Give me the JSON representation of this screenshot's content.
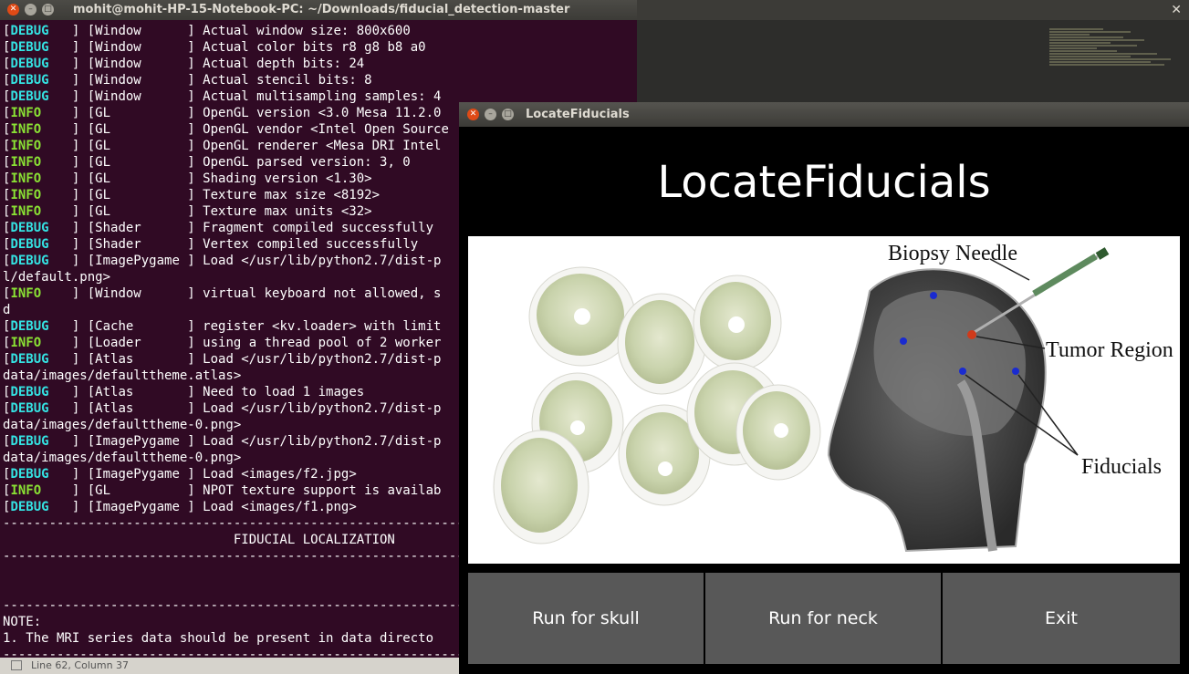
{
  "terminal": {
    "title": "mohit@mohit-HP-15-Notebook-PC: ~/Downloads/fiducial_detection-master",
    "lines": [
      {
        "level": "DEBUG",
        "text": "   ] [Window      ] Actual window size: 800x600"
      },
      {
        "level": "DEBUG",
        "text": "   ] [Window      ] Actual color bits r8 g8 b8 a0"
      },
      {
        "level": "DEBUG",
        "text": "   ] [Window      ] Actual depth bits: 24"
      },
      {
        "level": "DEBUG",
        "text": "   ] [Window      ] Actual stencil bits: 8"
      },
      {
        "level": "DEBUG",
        "text": "   ] [Window      ] Actual multisampling samples: 4"
      },
      {
        "level": "INFO",
        "text": "    ] [GL          ] OpenGL version <3.0 Mesa 11.2.0"
      },
      {
        "level": "INFO",
        "text": "    ] [GL          ] OpenGL vendor <Intel Open Source"
      },
      {
        "level": "INFO",
        "text": "    ] [GL          ] OpenGL renderer <Mesa DRI Intel"
      },
      {
        "level": "INFO",
        "text": "    ] [GL          ] OpenGL parsed version: 3, 0"
      },
      {
        "level": "INFO",
        "text": "    ] [GL          ] Shading version <1.30>"
      },
      {
        "level": "INFO",
        "text": "    ] [GL          ] Texture max size <8192>"
      },
      {
        "level": "INFO",
        "text": "    ] [GL          ] Texture max units <32>"
      },
      {
        "level": "DEBUG",
        "text": "   ] [Shader      ] Fragment compiled successfully"
      },
      {
        "level": "DEBUG",
        "text": "   ] [Shader      ] Vertex compiled successfully"
      },
      {
        "level": "DEBUG",
        "text": "   ] [ImagePygame ] Load </usr/lib/python2.7/dist-p"
      },
      {
        "level": "",
        "text": "l/default.png>"
      },
      {
        "level": "INFO",
        "text": "    ] [Window      ] virtual keyboard not allowed, s"
      },
      {
        "level": "",
        "text": "d"
      },
      {
        "level": "DEBUG",
        "text": "   ] [Cache       ] register <kv.loader> with limit"
      },
      {
        "level": "INFO",
        "text": "    ] [Loader      ] using a thread pool of 2 worker"
      },
      {
        "level": "DEBUG",
        "text": "   ] [Atlas       ] Load </usr/lib/python2.7/dist-p"
      },
      {
        "level": "",
        "text": "data/images/defaulttheme.atlas>"
      },
      {
        "level": "DEBUG",
        "text": "   ] [Atlas       ] Need to load 1 images"
      },
      {
        "level": "DEBUG",
        "text": "   ] [Atlas       ] Load </usr/lib/python2.7/dist-p"
      },
      {
        "level": "",
        "text": "data/images/defaulttheme-0.png>"
      },
      {
        "level": "DEBUG",
        "text": "   ] [ImagePygame ] Load </usr/lib/python2.7/dist-p"
      },
      {
        "level": "",
        "text": "data/images/defaulttheme-0.png>"
      },
      {
        "level": "DEBUG",
        "text": "   ] [ImagePygame ] Load <images/f2.jpg>"
      },
      {
        "level": "INFO",
        "text": "    ] [GL          ] NPOT texture support is availab"
      },
      {
        "level": "DEBUG",
        "text": "   ] [ImagePygame ] Load <images/f1.png>"
      },
      {
        "level": "",
        "text": "------------------------------------------------------------------------"
      },
      {
        "level": "",
        "text": "                              FIDUCIAL LOCALIZATION"
      },
      {
        "level": "",
        "text": "------------------------------------------------------------------------"
      },
      {
        "level": "",
        "text": ""
      },
      {
        "level": "",
        "text": ""
      },
      {
        "level": "",
        "text": "------------------------------------------------------------------------"
      },
      {
        "level": "",
        "text": "NOTE:"
      },
      {
        "level": "",
        "text": "1. The MRI series data should be present in data directo"
      },
      {
        "level": "",
        "text": "------------------------------------------------------------------------"
      }
    ],
    "status": "Line 62, Column 37"
  },
  "app": {
    "window_title": "LocateFiducials",
    "heading": "LocateFiducials",
    "image_labels": {
      "needle": "Biopsy Needle",
      "tumor": "Tumor Region",
      "fiducials": "Fiducials"
    },
    "buttons": {
      "skull": "Run for skull",
      "neck": "Run for neck",
      "exit": "Exit"
    }
  },
  "colors": {
    "terminal_bg": "#300a24",
    "debug": "#34e2e2",
    "info": "#8ae234",
    "button_bg": "#585858",
    "close_button": "#df4a16"
  }
}
